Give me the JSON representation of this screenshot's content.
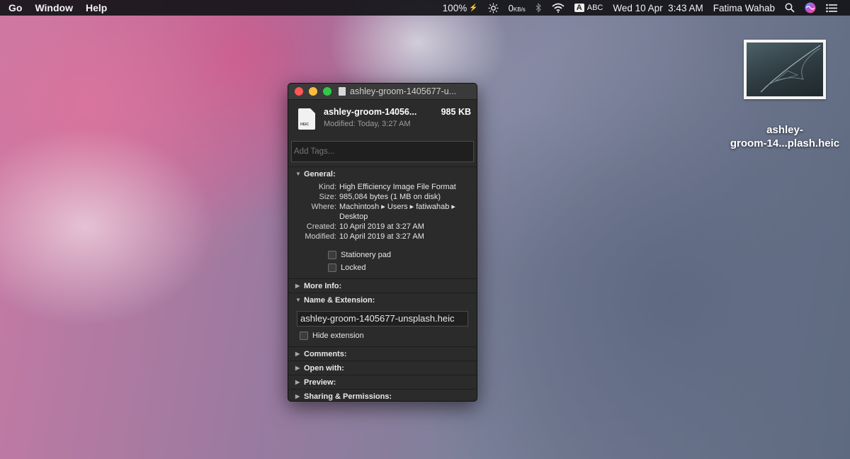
{
  "menubar": {
    "items": [
      "Go",
      "Window",
      "Help"
    ],
    "battery": "100%",
    "network": "0",
    "network_unit": "KB/s",
    "input_box": "A",
    "input_source": "ABC",
    "clock": "Wed 10 Apr  3:43 AM",
    "user": "Fatima Wahab"
  },
  "desktop_file": {
    "label_line1": "ashley-",
    "label_line2": "groom-14...plash.heic"
  },
  "window": {
    "title": "ashley-groom-1405677-u...",
    "file_name": "ashley-groom-14056...",
    "file_size": "985 KB",
    "modified": "Modified: Today, 3:27 AM",
    "icon_label": "HEIC",
    "tags_placeholder": "Add Tags..."
  },
  "general": {
    "header": "General:",
    "rows": [
      {
        "k": "Kind:",
        "v": "High Efficiency Image File Format"
      },
      {
        "k": "Size:",
        "v": "985,084 bytes (1 MB on disk)"
      },
      {
        "k": "Where:",
        "v": "Machintosh ▸ Users ▸ fatiwahab ▸"
      },
      {
        "k": "",
        "v": "Desktop"
      },
      {
        "k": "Created:",
        "v": "10 April 2019 at 3:27 AM"
      },
      {
        "k": "Modified:",
        "v": "10 April 2019 at 3:27 AM"
      }
    ],
    "stationery": "Stationery pad",
    "locked": "Locked"
  },
  "sections": {
    "more_info": "More Info:",
    "name_ext": "Name & Extension:",
    "name_value": "ashley-groom-1405677-unsplash.heic",
    "hide_ext": "Hide extension",
    "comments": "Comments:",
    "open_with": "Open with:",
    "preview": "Preview:",
    "sharing": "Sharing & Permissions:"
  }
}
